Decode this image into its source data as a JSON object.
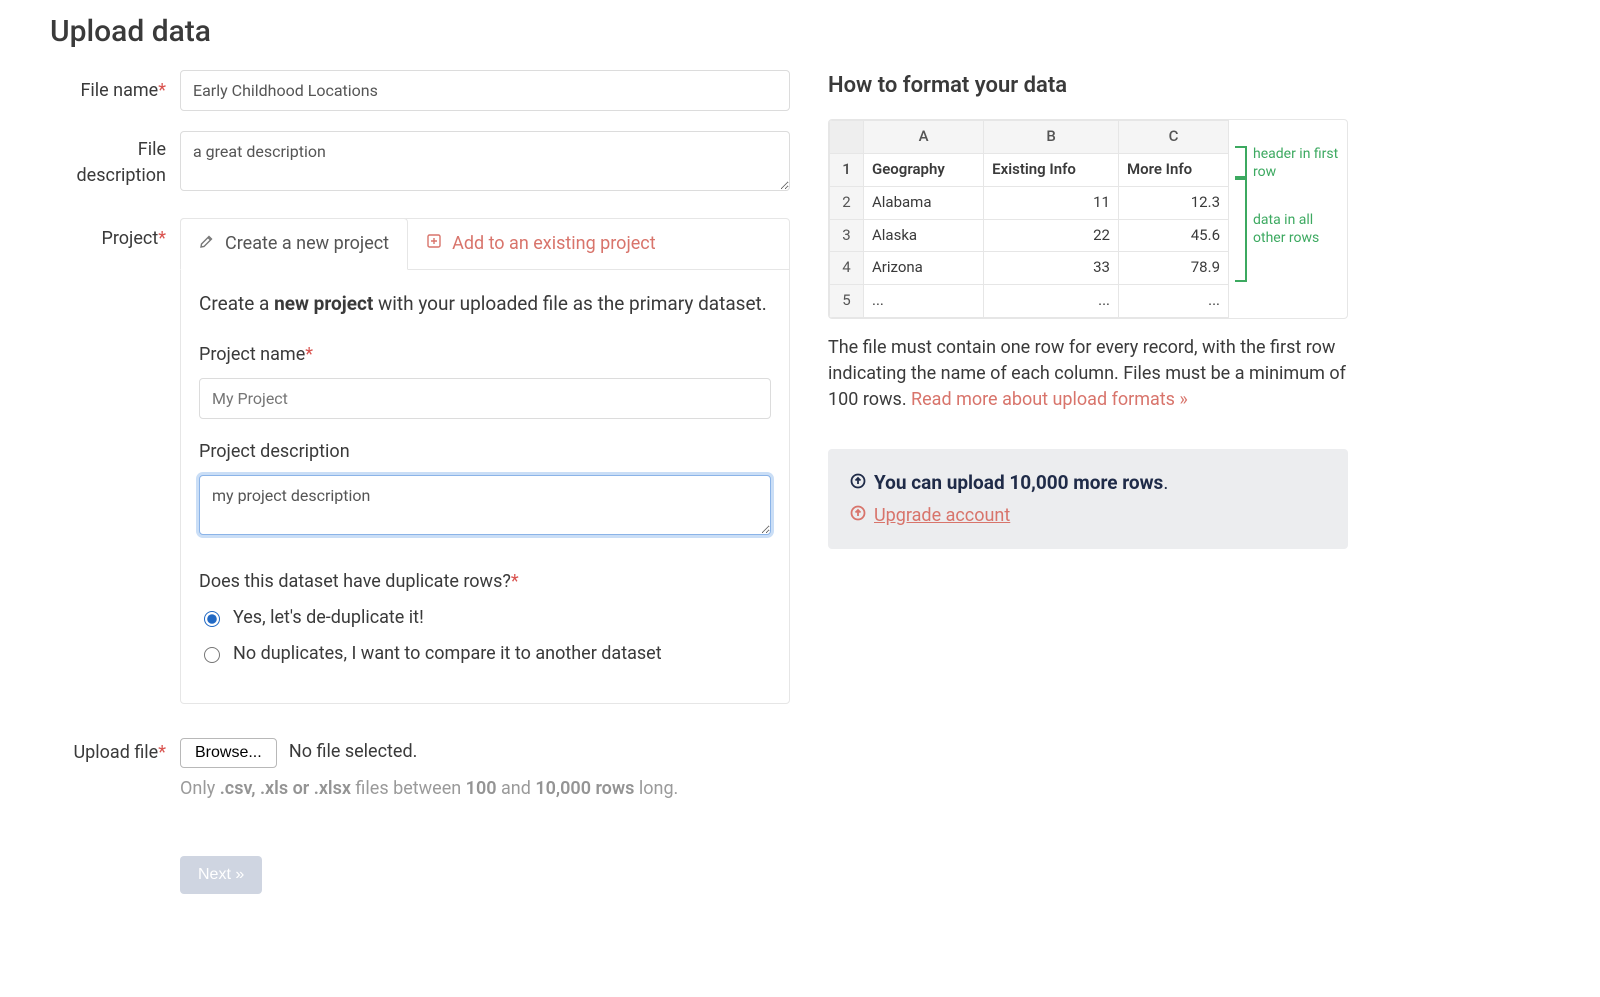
{
  "page_title": "Upload data",
  "labels": {
    "file_name": "File name",
    "file_description": "File description",
    "project": "Project",
    "upload_file": "Upload file"
  },
  "fields": {
    "file_name_value": "Early Childhood Locations",
    "file_description_value": "a great description"
  },
  "project_tabs": {
    "create": "Create a new project",
    "add": "Add to an existing project"
  },
  "project_panel": {
    "intro_pre": "Create a ",
    "intro_strong": "new project",
    "intro_post": " with your uploaded file as the primary dataset.",
    "name_label": "Project name",
    "name_placeholder": "My Project",
    "desc_label": "Project description",
    "desc_value": "my project description",
    "dup_label": "Does this dataset have duplicate rows?",
    "dup_yes": "Yes, let's de-duplicate it!",
    "dup_no": "No duplicates, I want to compare it to another dataset"
  },
  "upload": {
    "browse": "Browse...",
    "nofile": "No file selected.",
    "hint_pre": "Only ",
    "hint_ext": ".csv, .xls or .xlsx",
    "hint_mid1": " files between ",
    "hint_min": "100",
    "hint_mid2": " and ",
    "hint_max": "10,000 rows",
    "hint_post": " long."
  },
  "next_label": "Next »",
  "howto": {
    "title": "How to format your data",
    "sheet": {
      "cols": [
        "A",
        "B",
        "C"
      ],
      "header_row": [
        "Geography",
        "Existing Info",
        "More Info"
      ],
      "rows": [
        [
          "Alabama",
          "11",
          "12.3"
        ],
        [
          "Alaska",
          "22",
          "45.6"
        ],
        [
          "Arizona",
          "33",
          "78.9"
        ],
        [
          "...",
          "...",
          "..."
        ]
      ]
    },
    "annot1": "header in first row",
    "annot2": "data in all other rows",
    "desc_pre": "The file must contain one row for every record, with the first row indicating the name of each column. Files must be a minimum of 100 rows. ",
    "desc_link": "Read more about upload formats »"
  },
  "well": {
    "line1_strong": "You can upload 10,000 more rows",
    "line1_tail": ".",
    "line2": "Upgrade account"
  }
}
